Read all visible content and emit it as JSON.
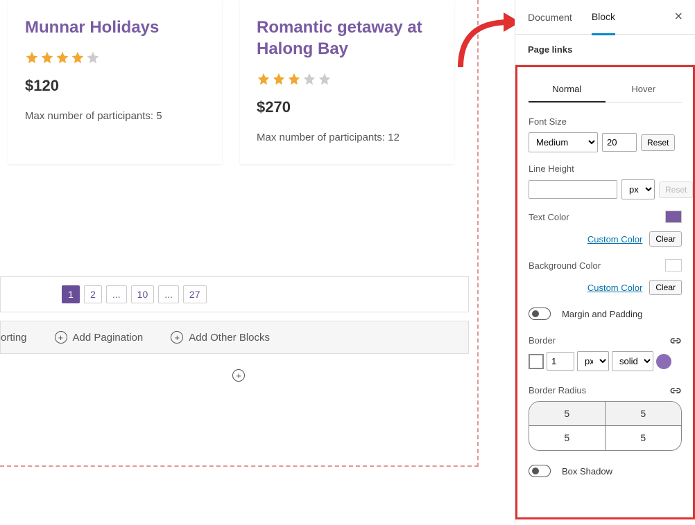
{
  "cards": [
    {
      "title": "Munnar Holidays",
      "rating": 4,
      "price": "$120",
      "max_label": "Max number of participants: 5"
    },
    {
      "title": "Romantic getaway at Halong Bay",
      "rating": 3,
      "price": "$270",
      "max_label": "Max number of participants: 12"
    }
  ],
  "pagination": {
    "p1": "1",
    "p2": "2",
    "dots": "...",
    "p10": "10",
    "p27": "27"
  },
  "toolbar": {
    "sorting": "orting",
    "add_pagination": "Add Pagination",
    "add_other": "Add Other Blocks"
  },
  "sidebar": {
    "tab_document": "Document",
    "tab_block": "Block",
    "section": "Page links",
    "subtab_normal": "Normal",
    "subtab_hover": "Hover",
    "font_size_label": "Font Size",
    "font_size_select": "Medium",
    "font_size_value": "20",
    "reset": "Reset",
    "line_height_label": "Line Height",
    "line_height_value": "",
    "unit_px": "px",
    "text_color_label": "Text Color",
    "text_color": "#7a5ba1",
    "custom_color": "Custom Color",
    "clear": "Clear",
    "bg_color_label": "Background Color",
    "bg_color": "#ffffff",
    "margin_padding": "Margin and Padding",
    "border_label": "Border",
    "border_width": "1",
    "border_style": "solid",
    "border_radius_label": "Border Radius",
    "radius": {
      "tl": "5",
      "tr": "5",
      "bl": "5",
      "br": "5"
    },
    "box_shadow": "Box Shadow"
  }
}
